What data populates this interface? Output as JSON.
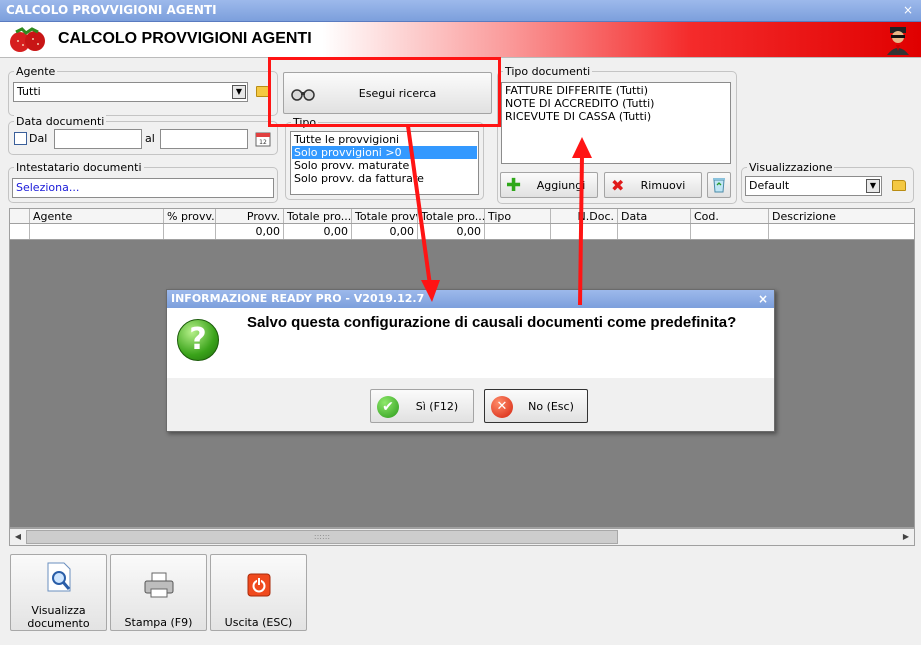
{
  "window": {
    "title": "CALCOLO PROVVIGIONI AGENTI",
    "close_glyph": "×"
  },
  "header": {
    "title": "CALCOLO PROVVIGIONI AGENTI"
  },
  "agente": {
    "label": "Agente",
    "value": "Tutti"
  },
  "data_documenti": {
    "label": "Data documenti",
    "dal_label": "Dal",
    "al_label": "al",
    "dal_value": "",
    "al_value": ""
  },
  "intestatario": {
    "label": "Intestatario documenti",
    "value": "Seleziona..."
  },
  "search": {
    "label": "Esegui ricerca"
  },
  "tipo": {
    "label": "Tipo",
    "items": [
      "Tutte le provvigioni",
      "Solo provvigioni >0",
      "Solo provv. maturate",
      "Solo provv. da fatturare"
    ],
    "selected_index": 1
  },
  "tipo_documenti": {
    "label": "Tipo documenti",
    "items": [
      "FATTURE DIFFERITE (Tutti)",
      "NOTE DI ACCREDITO (Tutti)",
      "RICEVUTE DI CASSA (Tutti)"
    ],
    "add_label": "Aggiungi",
    "remove_label": "Rimuovi"
  },
  "visualizzazione": {
    "label": "Visualizzazione",
    "value": "Default"
  },
  "grid": {
    "columns": [
      "",
      "Agente",
      "% provv.",
      "Provv.",
      "Totale pro...",
      "Totale provv...",
      "Totale pro...",
      "Tipo",
      "N.Doc.",
      "Data",
      "Cod.",
      "Descrizione"
    ],
    "row": [
      "",
      "",
      "",
      "0,00",
      "0,00",
      "0,00",
      "0,00",
      "",
      "",
      "",
      "",
      ""
    ]
  },
  "toolbar": {
    "visualizza_line1": "Visualizza",
    "visualizza_line2": "documento",
    "stampa": "Stampa (F9)",
    "uscita": "Uscita (ESC)"
  },
  "dialog": {
    "title": "INFORMAZIONE READY PRO - V2019.12.7",
    "close_glyph": "×",
    "message": "Salvo questa configurazione di causali documenti come predefinita?",
    "yes_label": "Sì (F12)",
    "no_label": "No (Esc)",
    "question_glyph": "?"
  },
  "colors": {
    "annotation_red": "#ff1414",
    "title_blue": "#7c9fdc",
    "selection": "#3399ff"
  }
}
